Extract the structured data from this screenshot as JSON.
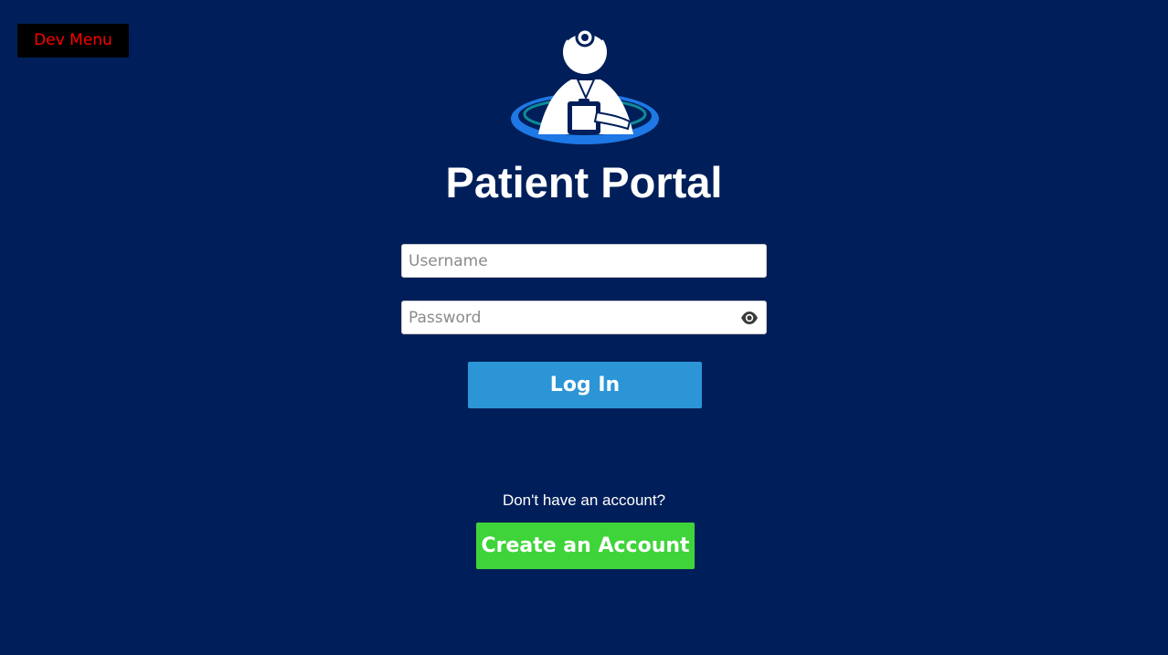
{
  "dev_menu": {
    "label": "Dev Menu",
    "text_color": "#ff0000",
    "background": "#000000"
  },
  "logo": {
    "icon": "doctor-logo-icon"
  },
  "title": "Patient Portal",
  "login_form": {
    "username": {
      "value": "",
      "placeholder": "Username"
    },
    "password": {
      "value": "",
      "placeholder": "Password",
      "toggle_icon": "eye-icon"
    },
    "login_label": "Log In"
  },
  "signup": {
    "prompt": "Don't have an account?",
    "create_label": "Create an Account"
  },
  "colors": {
    "background": "#001f5a",
    "login_button": "#2b95d6",
    "create_button": "#3fd43a"
  }
}
